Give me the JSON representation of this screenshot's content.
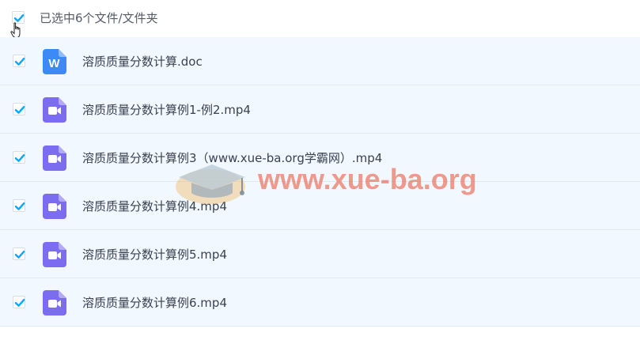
{
  "header": {
    "select_all_checked": true,
    "selection_label": "已选中6个文件/文件夹"
  },
  "files": [
    {
      "name": "溶质质量分数计算.doc",
      "type": "word",
      "checked": true
    },
    {
      "name": "溶质质量分数计算例1-例2.mp4",
      "type": "video",
      "checked": true
    },
    {
      "name": "溶质质量分数计算例3（www.xue-ba.org学霸网）.mp4",
      "type": "video",
      "checked": true
    },
    {
      "name": "溶质质量分数计算例4.mp4",
      "type": "video",
      "checked": true
    },
    {
      "name": "溶质质量分数计算例5.mp4",
      "type": "video",
      "checked": true
    },
    {
      "name": "溶质质量分数计算例6.mp4",
      "type": "video",
      "checked": true
    }
  ],
  "icons": {
    "word_letter": "W",
    "word_color": "#3d8af7",
    "video_color": "#7b6cf0",
    "check_color": "#06a7ff"
  },
  "watermark": {
    "text": "www.xue-ba.org"
  }
}
